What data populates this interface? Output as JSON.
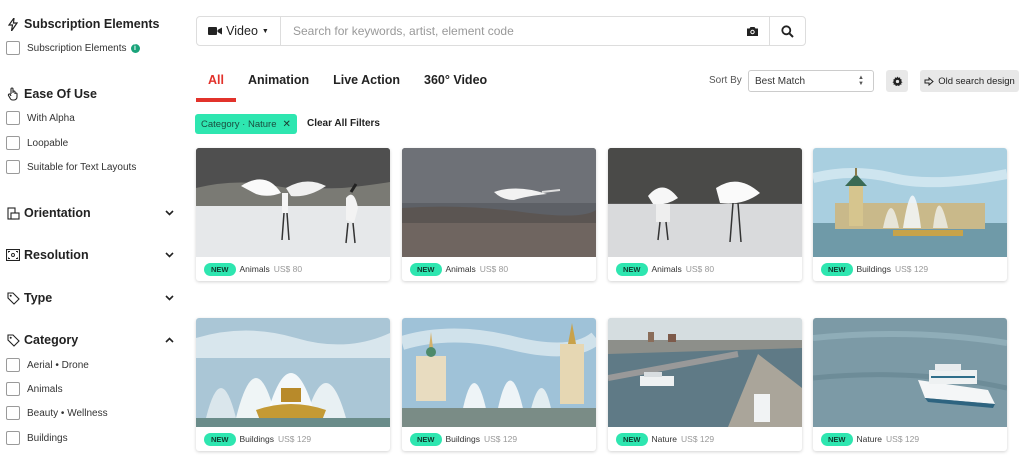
{
  "sidebar": {
    "subscription": {
      "title": "Subscription Elements",
      "options": [
        {
          "label": "Subscription Elements"
        }
      ]
    },
    "ease_of_use": {
      "title": "Ease Of Use",
      "options": [
        {
          "label": "With Alpha"
        },
        {
          "label": "Loopable"
        },
        {
          "label": "Suitable for Text Layouts"
        }
      ]
    },
    "orientation": {
      "title": "Orientation"
    },
    "resolution": {
      "title": "Resolution"
    },
    "type": {
      "title": "Type"
    },
    "category": {
      "title": "Category",
      "options": [
        {
          "label": "Aerial • Drone"
        },
        {
          "label": "Animals"
        },
        {
          "label": "Beauty • Wellness"
        },
        {
          "label": "Buildings"
        }
      ]
    }
  },
  "search": {
    "media_type": "Video",
    "placeholder": "Search for keywords, artist, element code",
    "value": ""
  },
  "tabs": [
    {
      "label": "All",
      "active": true
    },
    {
      "label": "Animation"
    },
    {
      "label": "Live Action"
    },
    {
      "label": "360° Video"
    }
  ],
  "sort": {
    "label": "Sort By",
    "value": "Best Match"
  },
  "old_design_label": "Old search design",
  "filters": {
    "chips": [
      {
        "label": "Category · Nature",
        "remove": "✕"
      }
    ],
    "clear_all": "Clear All Filters"
  },
  "results": [
    {
      "badge": "NEW",
      "category": "Animals",
      "price": "US$ 80",
      "scene": "cranes-dance"
    },
    {
      "badge": "NEW",
      "category": "Animals",
      "price": "US$ 80",
      "scene": "crane-flight"
    },
    {
      "badge": "NEW",
      "category": "Animals",
      "price": "US$ 80",
      "scene": "cranes-snow"
    },
    {
      "badge": "NEW",
      "category": "Buildings",
      "price": "US$ 129",
      "scene": "fountain-pavilion"
    },
    {
      "badge": "NEW",
      "category": "Buildings",
      "price": "US$ 129",
      "scene": "golden-fountain"
    },
    {
      "badge": "NEW",
      "category": "Buildings",
      "price": "US$ 129",
      "scene": "fountain-towers"
    },
    {
      "badge": "NEW",
      "category": "Nature",
      "price": "US$ 129",
      "scene": "river-city"
    },
    {
      "badge": "NEW",
      "category": "Nature",
      "price": "US$ 129",
      "scene": "river-boat"
    }
  ],
  "colors": {
    "accent_tab": "#e2322b",
    "chip": "#2ee6b0",
    "badge_new": "#2ee6b0"
  }
}
